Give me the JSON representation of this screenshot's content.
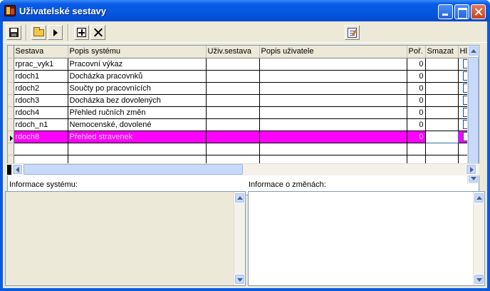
{
  "window": {
    "title": "Uživatelské sestavy"
  },
  "icons": {
    "save": "save-icon",
    "open": "folder-open-icon",
    "run": "play-icon",
    "add": "add-icon",
    "delete": "delete-icon",
    "edit": "edit-icon"
  },
  "grid": {
    "columns": [
      "Sestava",
      "Popis systému",
      "Uživ.sestava",
      "Popis uživatele",
      "Poř.",
      "Smazat",
      "Hl."
    ],
    "rows": [
      {
        "sestava": "rprac_vyk1",
        "popis": "Pracovní výkaz",
        "uziv": "",
        "popis_uziv": "",
        "por": "0"
      },
      {
        "sestava": "rdoch1",
        "popis": "Docházka pracovnků",
        "uziv": "",
        "popis_uziv": "",
        "por": "0"
      },
      {
        "sestava": "rdoch2",
        "popis": "Součty po pracovnících",
        "uziv": "",
        "popis_uziv": "",
        "por": "0"
      },
      {
        "sestava": "rdoch3",
        "popis": "Docházka bez dovolených",
        "uziv": "",
        "popis_uziv": "",
        "por": "0"
      },
      {
        "sestava": "rdoch4",
        "popis": "Přehled ručních změn",
        "uziv": "",
        "popis_uziv": "",
        "por": "0"
      },
      {
        "sestava": "rdoch_n1",
        "popis": "Nemocenské, dovolené",
        "uziv": "",
        "popis_uziv": "",
        "por": "0"
      },
      {
        "sestava": "rdoch8",
        "popis": "Přehled stravenek",
        "uziv": "",
        "popis_uziv": "",
        "por": "0"
      }
    ],
    "selected_color": "#ff00ff"
  },
  "panels": {
    "system_info_label": "Informace systému:",
    "changes_info_label": "Informace o změnách:"
  }
}
